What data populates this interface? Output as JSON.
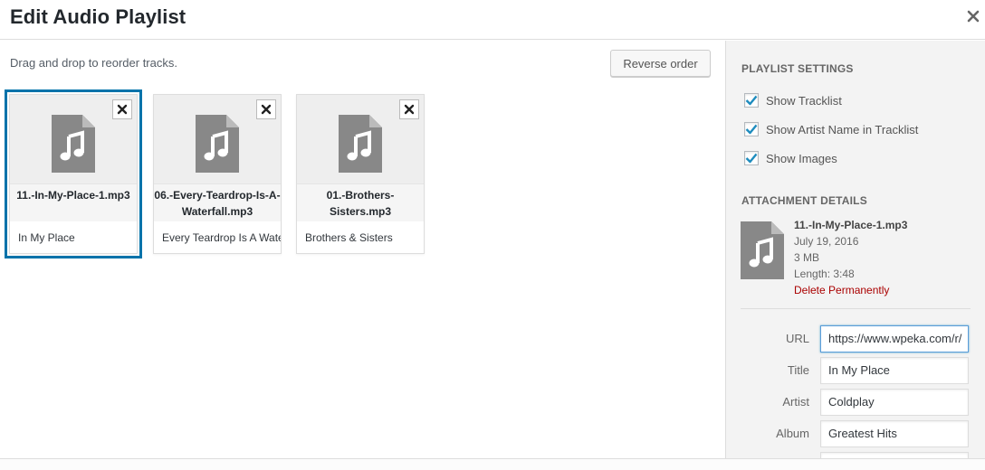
{
  "header": {
    "title": "Edit Audio Playlist",
    "close_label": "×"
  },
  "main": {
    "instructions": "Drag and drop to reorder tracks.",
    "reverse_label": "Reverse order",
    "tracks": [
      {
        "filename": "11.-In-My-Place-1.mp3",
        "title": "In My Place",
        "selected": true
      },
      {
        "filename": "06.-Every-Teardrop-Is-A-Waterfall.mp3",
        "title": "Every Teardrop Is A Waterfall",
        "selected": false
      },
      {
        "filename": "01.-Brothers-Sisters.mp3",
        "title": "Brothers & Sisters",
        "selected": false
      }
    ]
  },
  "sidebar": {
    "settings_heading": "PLAYLIST SETTINGS",
    "settings": [
      {
        "label": "Show Tracklist",
        "checked": true
      },
      {
        "label": "Show Artist Name in Tracklist",
        "checked": true
      },
      {
        "label": "Show Images",
        "checked": true
      }
    ],
    "details_heading": "ATTACHMENT DETAILS",
    "attachment": {
      "filename": "11.-In-My-Place-1.mp3",
      "date": "July 19, 2016",
      "size": "3 MB",
      "length": "Length: 3:48",
      "delete_label": "Delete Permanently"
    },
    "fields": [
      {
        "label": "URL",
        "value": "https://www.wpeka.com/r/",
        "focused": true
      },
      {
        "label": "Title",
        "value": "In My Place",
        "focused": false
      },
      {
        "label": "Artist",
        "value": "Coldplay",
        "focused": false
      },
      {
        "label": "Album",
        "value": "Greatest Hits",
        "focused": false
      }
    ]
  },
  "colors": {
    "accent": "#0073aa",
    "delete": "#a00",
    "icon": "#888888"
  },
  "icons": {
    "close": "close-icon",
    "audio": "audio-file-icon",
    "remove": "remove-icon",
    "check": "checkmark-icon"
  }
}
